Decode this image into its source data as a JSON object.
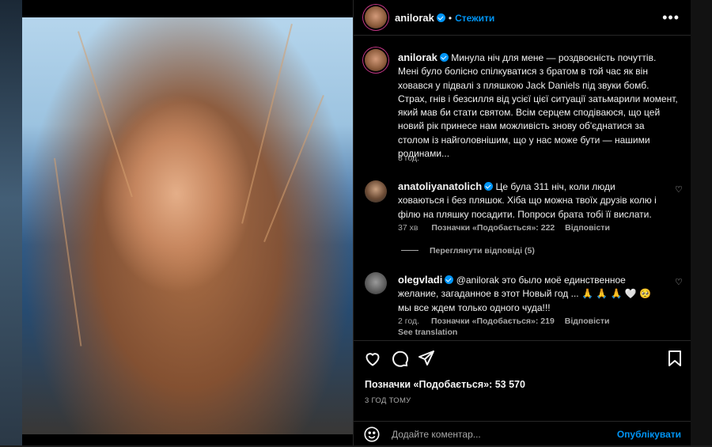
{
  "post": {
    "author": "anilorak",
    "follow_label": "Стежити",
    "dot": "•",
    "more_label": "•••"
  },
  "caption": {
    "author": "anilorak",
    "text": "Минула ніч для мене — роздвоєність почуттів. Мені було болісно спілкуватися з братом в той час як він ховався у підвалі з пляшкою Jack Daniels під звуки бомб. Страх, гнів і безсилля від усієї цієї ситуації затьмарили момент, який мав би стати святом. Всім серцем сподіваюся, що цей новий рік принесе нам можливість знову об'єднатися за столом із найголовнішим, що у нас може бути — нашими родинами...",
    "time": "3 год."
  },
  "comments": [
    {
      "author": "anatoliyanatolich",
      "text": "Це була 311 ніч, коли люди ховаються і без пляшок. Хіба що можна твоїх друзів колю і філю на пляшку посадити. Попроси брата тобі її вислати.",
      "time": "37 хв",
      "likes": "Позначки «Подобається»: 222",
      "reply": "Відповісти",
      "view_replies": "Переглянути відповіді (5)"
    },
    {
      "author": "olegvladi",
      "text": "@anilorak это было моё единственное желание, загаданное в этот Новый год ... 🙏 🙏 🙏 🤍 🥺 мы все ждем только одного чуда!!!",
      "time": "2 год.",
      "likes": "Позначки «Подобається»: 219",
      "reply": "Відповісти",
      "see_translation": "See translation"
    }
  ],
  "footer": {
    "likes": "Позначки «Подобається»: 53 570",
    "time_ago": "3 ГОД ТОМУ",
    "comment_placeholder": "Додайте коментар...",
    "publish_label": "Опублікувати"
  },
  "colors": {
    "accent": "#0095f6",
    "panel_bg": "#000000",
    "muted_text": "#a8a8a8"
  },
  "icons": [
    "heart-icon",
    "comment-icon",
    "share-icon",
    "bookmark-icon",
    "emoji-icon",
    "more-icon",
    "verified-icon"
  ]
}
